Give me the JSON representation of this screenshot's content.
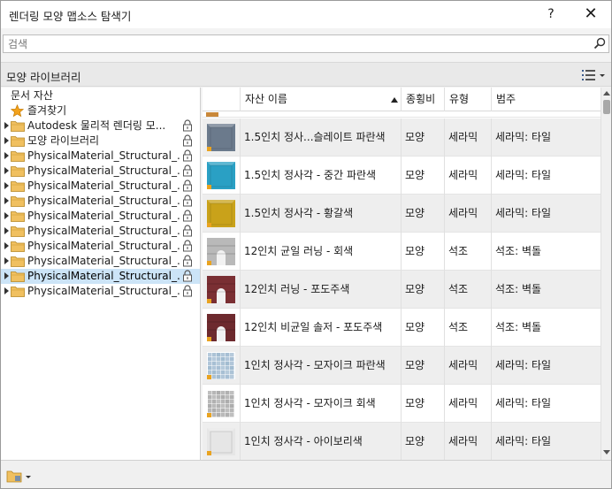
{
  "window": {
    "title": "렌더링 모양 맵소스 탐색기",
    "help_label": "?",
    "close_label": "✕"
  },
  "search": {
    "placeholder": "검색",
    "value": ""
  },
  "library_header": {
    "title": "모양 라이브러리"
  },
  "tree": {
    "document_assets": "문서 자산",
    "favorites": "즐겨찾기",
    "items": [
      {
        "label": "Autodesk 물리적 렌더링 모...",
        "locked": true,
        "selected": false
      },
      {
        "label": "모양 라이브러리",
        "locked": true,
        "selected": false
      },
      {
        "label": "PhysicalMaterial_Structural_...",
        "locked": true,
        "selected": false
      },
      {
        "label": "PhysicalMaterial_Structural_...",
        "locked": true,
        "selected": false
      },
      {
        "label": "PhysicalMaterial_Structural_...",
        "locked": true,
        "selected": false
      },
      {
        "label": "PhysicalMaterial_Structural_...",
        "locked": true,
        "selected": false
      },
      {
        "label": "PhysicalMaterial_Structural_...",
        "locked": true,
        "selected": false
      },
      {
        "label": "PhysicalMaterial_Structural_...",
        "locked": true,
        "selected": false
      },
      {
        "label": "PhysicalMaterial_Structural_...",
        "locked": true,
        "selected": false
      },
      {
        "label": "PhysicalMaterial_Structural_...",
        "locked": true,
        "selected": false
      },
      {
        "label": "PhysicalMaterial_Structural_...",
        "locked": true,
        "selected": true
      },
      {
        "label": "PhysicalMaterial_Structural_...",
        "locked": true,
        "selected": false
      }
    ]
  },
  "table": {
    "columns": [
      "자산 이름",
      "종횡비",
      "유형",
      "범주"
    ],
    "rows": [
      {
        "name": "1.5인치 정사...슬레이트 파란색",
        "aspect": "모양",
        "type": "세라믹",
        "category": "세라믹: 타일",
        "swatch": "#6b7a8c",
        "style": "cube"
      },
      {
        "name": "1.5인치 정사각 - 중간 파란색",
        "aspect": "모양",
        "type": "세라믹",
        "category": "세라믹: 타일",
        "swatch": "#2aa0c4",
        "style": "cube"
      },
      {
        "name": "1.5인치 정사각 - 황갈색",
        "aspect": "모양",
        "type": "세라믹",
        "category": "세라믹: 타일",
        "swatch": "#c9a21a",
        "style": "cube"
      },
      {
        "name": "12인치 균일 러닝 - 회색",
        "aspect": "모양",
        "type": "석조",
        "category": "석조: 벽돌",
        "swatch": "#b9b9b9",
        "style": "arch"
      },
      {
        "name": "12인치 러닝 - 포도주색",
        "aspect": "모양",
        "type": "석조",
        "category": "석조: 벽돌",
        "swatch": "#7a2f33",
        "style": "arch"
      },
      {
        "name": "12인치 비균일 솔저 - 포도주색",
        "aspect": "모양",
        "type": "석조",
        "category": "석조: 벽돌",
        "swatch": "#6d2a2e",
        "style": "arch"
      },
      {
        "name": "1인치 정사각 - 모자이크 파란색",
        "aspect": "모양",
        "type": "세라믹",
        "category": "세라믹: 타일",
        "swatch": "#9db8cf",
        "style": "mosaic"
      },
      {
        "name": "1인치 정사각 - 모자이크 회색",
        "aspect": "모양",
        "type": "세라믹",
        "category": "세라믹: 타일",
        "swatch": "#a9a9a9",
        "style": "mosaic"
      },
      {
        "name": "1인치 정사각 - 아이보리색",
        "aspect": "모양",
        "type": "세라믹",
        "category": "세라믹: 타일",
        "swatch": "#e6e6e6",
        "style": "cube"
      }
    ]
  },
  "colors": {
    "selection": "#cce4f7",
    "folder": "#f0c060",
    "favorite_star": "#f3a21c"
  }
}
